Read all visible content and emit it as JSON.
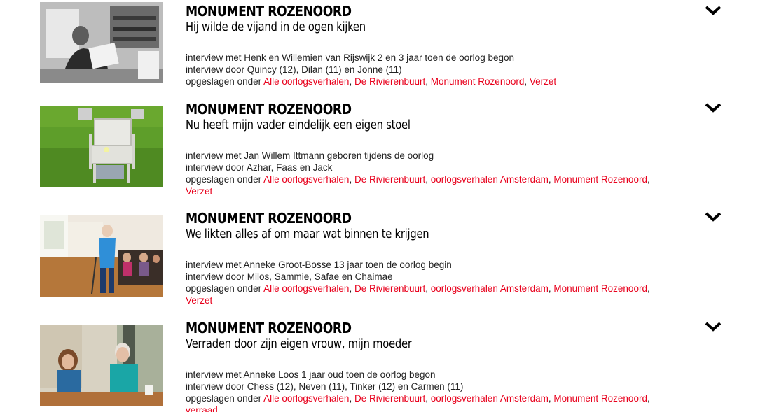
{
  "stories": [
    {
      "kicker": "MONUMENT ROZENOORD",
      "title": "Hij wilde de vijand in de ogen kijken",
      "interview_with": "interview met Henk en Willemien van Rijswijk 2 en 3 jaar toen de oorlog begon",
      "interview_by": "interview door Quincy (12), Dilan (11) en Jonne (11)",
      "filed_under": "opgeslagen onder",
      "tags": [
        "Alle oorlogsverhalen",
        "De Rivierenbuurt",
        "Monument Rozenoord",
        "Verzet"
      ]
    },
    {
      "kicker": "MONUMENT ROZENOORD",
      "title": "Nu heeft mijn vader eindelijk een eigen stoel",
      "interview_with": "interview met Jan Willem Ittmann geboren tijdens de oorlog",
      "interview_by": "interview door Azhar, Faas en Jack",
      "filed_under": "opgeslagen onder",
      "tags": [
        "Alle oorlogsverhalen",
        "De Rivierenbuurt",
        "oorlogsverhalen Amsterdam",
        "Monument Rozenoord",
        "Verzet"
      ]
    },
    {
      "kicker": "MONUMENT ROZENOORD",
      "title": "We likten alles af om maar wat binnen te krijgen",
      "interview_with": "interview met Anneke Groot-Bosse 13 jaar toen de oorlog begin",
      "interview_by": "interview door Milos, Sammie, Safae en Chaimae",
      "filed_under": "opgeslagen onder",
      "tags": [
        "Alle oorlogsverhalen",
        "De Rivierenbuurt",
        "oorlogsverhalen Amsterdam",
        "Monument Rozenoord",
        "Verzet"
      ]
    },
    {
      "kicker": "MONUMENT ROZENOORD",
      "title": "Verraden door zijn eigen vrouw, mijn moeder",
      "interview_with": "interview met Anneke Loos 1 jaar oud toen de oorlog begon",
      "interview_by": "interview door Chess (12), Neven (11), Tinker (12) en Carmen (11)",
      "filed_under": "opgeslagen onder",
      "tags": [
        "Alle oorlogsverhalen",
        "De Rivierenbuurt",
        "oorlogsverhalen Amsterdam",
        "Monument Rozenoord",
        "verraad"
      ]
    }
  ],
  "icons": {
    "expand": "chevron-down-icon"
  },
  "colors": {
    "tag": "#e8001c",
    "divider": "#222222",
    "text": "#1a1a1a"
  }
}
